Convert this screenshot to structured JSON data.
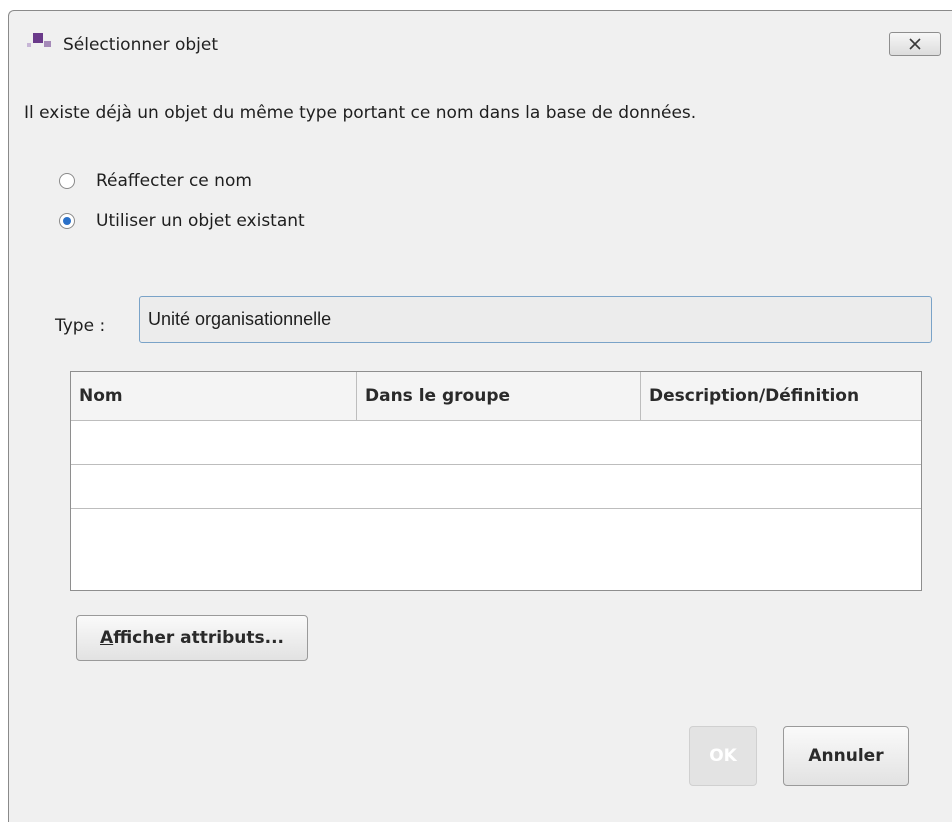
{
  "window": {
    "title": "Sélectionner objet"
  },
  "message": "Il existe déjà un objet du même type portant ce nom dans la base de données.",
  "options": [
    {
      "label": "Réaffecter ce nom",
      "selected": false
    },
    {
      "label": "Utiliser un objet existant",
      "selected": true
    }
  ],
  "type_field": {
    "label": "Type :",
    "value": "Unité organisationnelle"
  },
  "table": {
    "columns": [
      "Nom",
      "Dans le groupe",
      "Description/Définition"
    ],
    "rows": []
  },
  "buttons": {
    "show_attributes_mnemonic": "A",
    "show_attributes_rest": "fficher attributs...",
    "ok": "OK",
    "cancel": "Annuler"
  },
  "colors": {
    "accent": "#2a70c8",
    "icon_purple": "#6a3a8a",
    "icon_light": "#a58ab8"
  },
  "icons": {
    "app": "app-icon",
    "close": "close-icon"
  }
}
